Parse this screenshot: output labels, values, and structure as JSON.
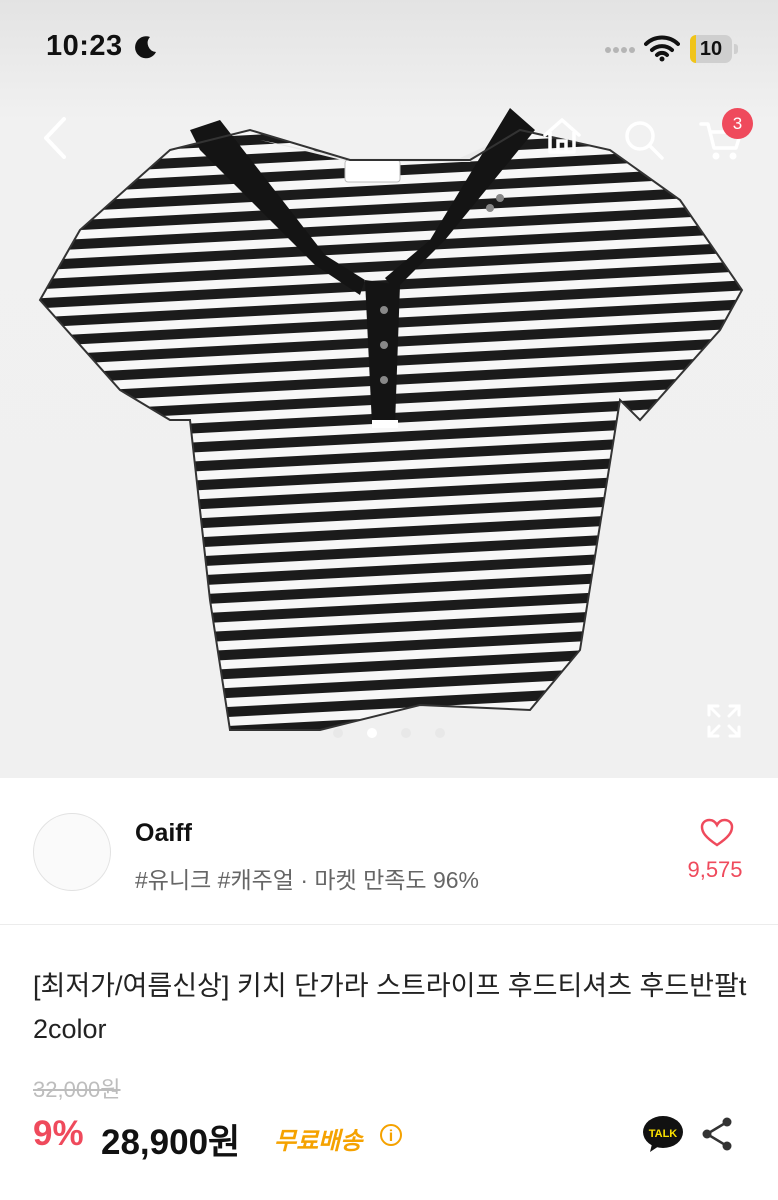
{
  "status_bar": {
    "time": "10:23",
    "battery": "10"
  },
  "nav": {
    "cart_count": "3"
  },
  "shop": {
    "name": "Oaiff",
    "tags": "#유니크 #캐주얼 · 마켓 만족도 96%",
    "likes": "9,575"
  },
  "product": {
    "title": "[최저가/여름신상] 키치  단가라 스트라이프 후드티셔츠 후드반팔t 2color",
    "original_price": "32,000원",
    "discount": "9%",
    "price": "28,900원",
    "shipping": "무료배송",
    "info_symbol": "i",
    "talk_label": "TALK"
  },
  "carousel": {
    "count": 4,
    "active": 2
  },
  "colors": {
    "accent": "#ef4a5c",
    "shipping": "#f5a200",
    "kakao": "#fae100"
  }
}
